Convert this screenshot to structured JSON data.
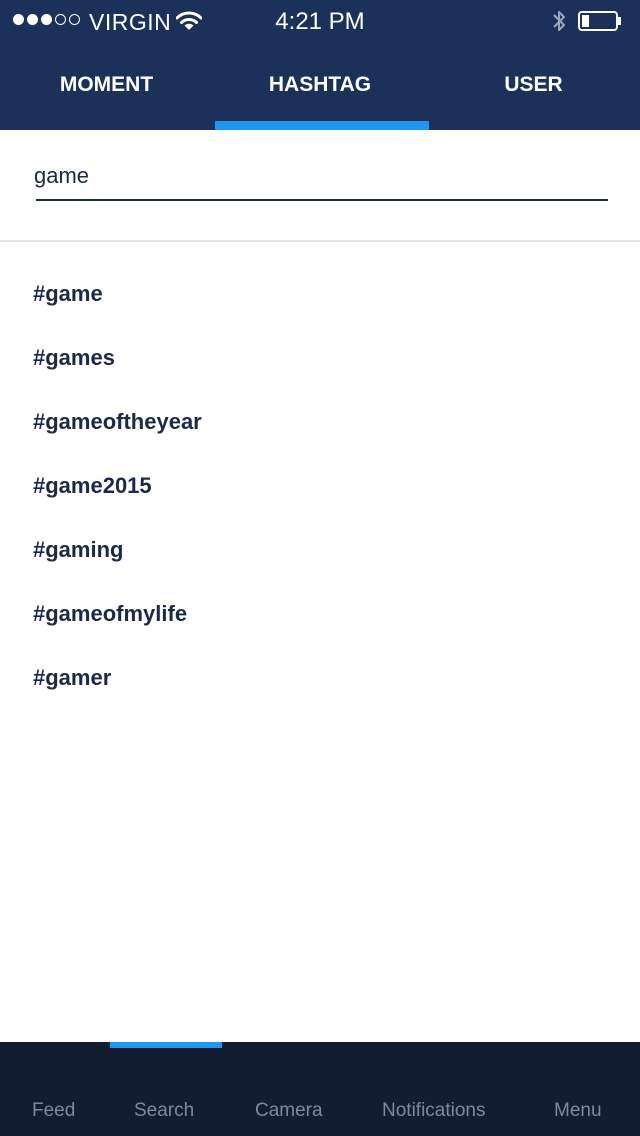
{
  "status_bar": {
    "carrier": "VIRGIN",
    "time": "4:21 PM",
    "signal_bars_filled": 3,
    "signal_bars_total": 5
  },
  "tabs": [
    {
      "label": "MOMENT",
      "active": false
    },
    {
      "label": "HASHTAG",
      "active": true
    },
    {
      "label": "USER",
      "active": false
    }
  ],
  "search": {
    "value": "game"
  },
  "results": [
    "#game",
    "#games",
    "#gameoftheyear",
    "#game2015",
    "#gaming",
    "#gameofmylife",
    "#gamer"
  ],
  "bottom_nav": {
    "items": [
      {
        "label": "Feed"
      },
      {
        "label": "Search",
        "active": true
      },
      {
        "label": "Camera"
      },
      {
        "label": "Notifications"
      },
      {
        "label": "Menu"
      }
    ]
  },
  "colors": {
    "header_bg": "#1b3159",
    "accent": "#1d97f0",
    "text_dark": "#1b2a46",
    "nav_bg": "#121d31",
    "nav_text": "#7c8aa0"
  },
  "icons": [
    "wifi-icon",
    "bluetooth-icon",
    "battery-icon",
    "signal-strength-icon"
  ]
}
